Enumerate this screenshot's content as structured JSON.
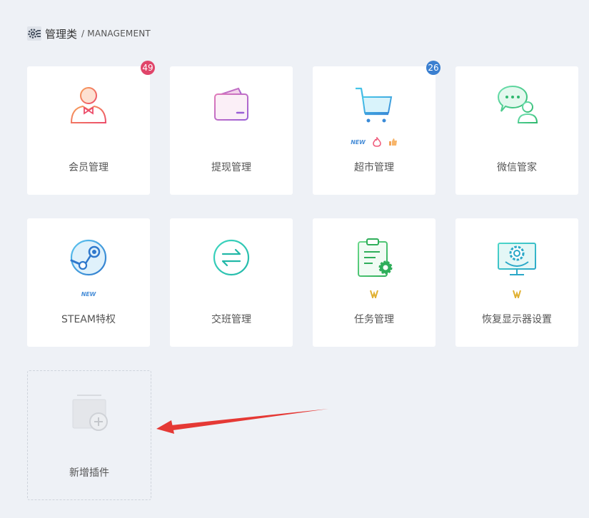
{
  "section": {
    "title": "管理类",
    "subtitle": "/ MANAGEMENT"
  },
  "colors": {
    "badge_red": "#e0456a",
    "badge_blue": "#3a7fd0",
    "page_bg": "#eef1f6"
  },
  "cards": [
    {
      "label": "会员管理",
      "icon": "member-icon",
      "badge": "49"
    },
    {
      "label": "提现管理",
      "icon": "wallet-icon"
    },
    {
      "label": "超市管理",
      "icon": "cart-icon",
      "badge": "26",
      "tag": "NEW"
    },
    {
      "label": "微信管家",
      "icon": "wechat-icon"
    },
    {
      "label": "STEAM特权",
      "icon": "steam-icon",
      "tag": "NEW"
    },
    {
      "label": "交班管理",
      "icon": "swap-icon"
    },
    {
      "label": "任务管理",
      "icon": "task-icon"
    },
    {
      "label": "恢复显示器设置",
      "icon": "monitor-settings-icon"
    },
    {
      "label": "新增插件",
      "icon": "add-plugin-icon"
    }
  ]
}
